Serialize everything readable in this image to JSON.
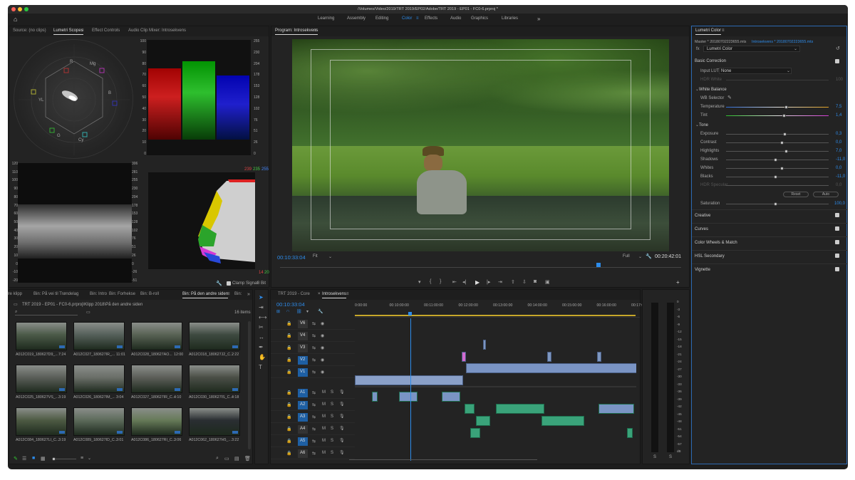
{
  "window": {
    "title": "/Volumes/Video/2019/TRT 2019/EP02/Adobe/TRT 2019 - EP01 - FC0-6.prproj *"
  },
  "workspaces": [
    "Learning",
    "Assembly",
    "Editing",
    "Color",
    "Effects",
    "Audio",
    "Graphics",
    "Libraries"
  ],
  "workspaces_more": "»",
  "active_workspace": "Color",
  "source_panel": {
    "tabs": [
      "Source: (no clips)",
      "Lumetri Scopes",
      "Effect Controls",
      "Audio Clip Mixer: Introsekvens"
    ],
    "active": "Lumetri Scopes"
  },
  "scopes": {
    "vector_labels": [
      "R",
      "Mg",
      "B",
      "Cy",
      "G",
      "YL"
    ],
    "parade_scale": [
      "100",
      "90",
      "80",
      "70",
      "60",
      "50",
      "40",
      "30",
      "20",
      "10",
      "0"
    ],
    "parade_scale_right": [
      "255",
      "230",
      "204",
      "178",
      "153",
      "128",
      "102",
      "76",
      "51",
      "26",
      "0"
    ],
    "waveform_scale": [
      "120",
      "110",
      "100",
      "90",
      "80",
      "70",
      "60",
      "50",
      "40",
      "30",
      "20",
      "10",
      "0",
      "-10",
      "-20"
    ],
    "waveform_scale_right": [
      "306",
      "281",
      "255",
      "230",
      "204",
      "178",
      "153",
      "128",
      "102",
      "76",
      "51",
      "26",
      "0",
      "-26",
      "-51"
    ],
    "hist_top": [
      "239",
      "235",
      "255"
    ],
    "hist_bottom": [
      "14",
      "20"
    ],
    "clamp_label": "Clamp Signal",
    "bit_depth": "8 Bit"
  },
  "program": {
    "title": "Program: Introsekvens",
    "timecode": "00:10:33:04",
    "fit": "Fit",
    "quality": "Full",
    "duration": "00:20:42:01"
  },
  "lumetri": {
    "title": "Lumetri Color",
    "master": "Master * 20180702223655.mts",
    "seq": "Introsekvens * 20180702223655.mts",
    "fx_label": "fx",
    "effect": "Lumetri Color",
    "basic_correction": "Basic Correction",
    "input_lut_label": "Input LUT",
    "input_lut_value": "None",
    "hdr_white": "HDR White",
    "hdr_white_value": "100",
    "white_balance": "White Balance",
    "wb_selector": "WB Selector",
    "tone": "Tone",
    "sliders": [
      {
        "label": "Temperature",
        "value": "7,5",
        "pos": 0.58
      },
      {
        "label": "Tint",
        "value": "1,4",
        "pos": 0.56
      }
    ],
    "tone_sliders": [
      {
        "label": "Exposure",
        "value": "0,3",
        "pos": 0.57
      },
      {
        "label": "Contrast",
        "value": "0,0",
        "pos": 0.54
      },
      {
        "label": "Highlights",
        "value": "7,0",
        "pos": 0.58
      },
      {
        "label": "Shadows",
        "value": "-11,0",
        "pos": 0.48
      },
      {
        "label": "Whites",
        "value": "0,0",
        "pos": 0.54
      },
      {
        "label": "Blacks",
        "value": "-11,0",
        "pos": 0.48
      },
      {
        "label": "HDR Specular",
        "value": "0,0",
        "pos": 0.54
      }
    ],
    "reset": "Reset",
    "auto": "Auto",
    "saturation_label": "Saturation",
    "saturation_value": "100,0",
    "sections": [
      "Creative",
      "Curves",
      "Color Wheels & Match",
      "HSL Secondary",
      "Vignette"
    ]
  },
  "bins": {
    "tabs": [
      "ndre klipp",
      "Bin: På vei til Trøndelag",
      "Bin: Intro",
      "Bin: Forhekse",
      "Bin: B-roll",
      "Bin: På den andre siden",
      "Bin:"
    ],
    "active": "Bin: På den andre siden",
    "path": "TRT 2019 - EP01 - FC0-6.prproj\\Klipp 2018\\På den andre siden",
    "count": "16 items",
    "clips": [
      {
        "name": "A012C019_180627D9_...",
        "dur": "7:24"
      },
      {
        "name": "A012C027_180627IR_...",
        "dur": "11:01"
      },
      {
        "name": "A012C028_180627AO...",
        "dur": "12:00"
      },
      {
        "name": "A012C018_180627J2_C...",
        "dur": "2:22"
      },
      {
        "name": "A012C025_180627VS_...",
        "dur": "3:19"
      },
      {
        "name": "A012C026_180627IM_...",
        "dur": "3:04"
      },
      {
        "name": "A012C027_180627IR_C...",
        "dur": "4:10"
      },
      {
        "name": "A012C030_180627IS_C...",
        "dur": "4:18"
      },
      {
        "name": "A012C084_180627LI_C...",
        "dur": "3:19"
      },
      {
        "name": "A012C089_180627ID_C...",
        "dur": "3:01"
      },
      {
        "name": "A012C086_180627RI_C...",
        "dur": "3:06"
      },
      {
        "name": "A012C062_180627H5_...",
        "dur": "3:22"
      }
    ]
  },
  "timeline": {
    "tabs": [
      "TRT 2019 - Core",
      "Introsekvens"
    ],
    "active": "Introsekvens",
    "timecode": "00:10:33:04",
    "ruler": [
      "0:00:00",
      "00:10:00:00",
      "00:11:00:00",
      "00:12:00:00",
      "00:13:00:00",
      "00:14:00:00",
      "00:15:00:00",
      "00:16:00:00",
      "00:17:00"
    ],
    "video_tracks": [
      "V6",
      "V4",
      "V3",
      "V2",
      "V1"
    ],
    "audio_tracks": [
      "A1",
      "A2",
      "A3",
      "A4",
      "A5",
      "A6"
    ],
    "m": "M",
    "s": "S"
  },
  "meter": {
    "scale": [
      "0",
      "-3",
      "-6",
      "-9",
      "-12",
      "-15",
      "-18",
      "-21",
      "-24",
      "-27",
      "-30",
      "-33",
      "-36",
      "-39",
      "-42",
      "-45",
      "-48",
      "-51",
      "-54",
      "-57",
      "dB"
    ],
    "bottom": [
      "S",
      "S"
    ]
  },
  "colors": {
    "accent": "#2d8ceb",
    "panel": "#232323",
    "bg": "#1d1d1d",
    "video_clip": "#7d96c0",
    "audio_clip": "#3aa37a"
  }
}
